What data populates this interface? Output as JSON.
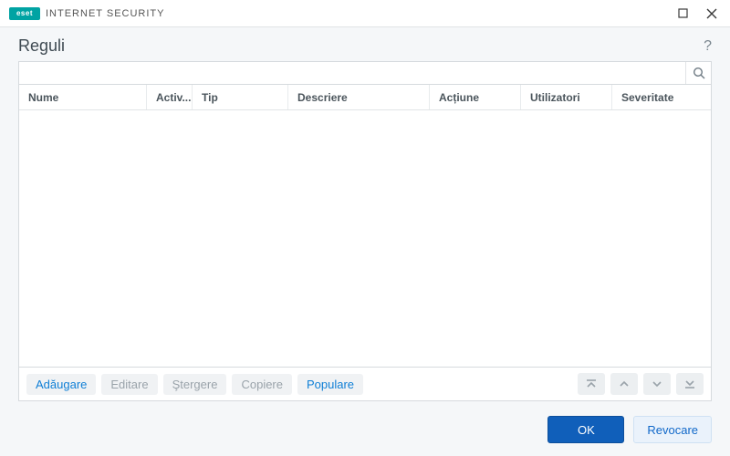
{
  "titlebar": {
    "brand_mark": "eset",
    "product": "INTERNET SECURITY"
  },
  "page": {
    "title": "Reguli"
  },
  "search": {
    "placeholder": ""
  },
  "table": {
    "columns": [
      {
        "label": "Nume",
        "width": 140
      },
      {
        "label": "Activ...",
        "width": 50
      },
      {
        "label": "Tip",
        "width": 105
      },
      {
        "label": "Descriere",
        "width": 155
      },
      {
        "label": "Acțiune",
        "width": 100
      },
      {
        "label": "Utilizatori",
        "width": 100
      },
      {
        "label": "Severitate",
        "width": 100
      }
    ],
    "rows": []
  },
  "actions": {
    "add": "Adăugare",
    "edit": "Editare",
    "delete": "Ştergere",
    "copy": "Copiere",
    "populate": "Populare"
  },
  "footer": {
    "ok": "OK",
    "cancel": "Revocare"
  }
}
